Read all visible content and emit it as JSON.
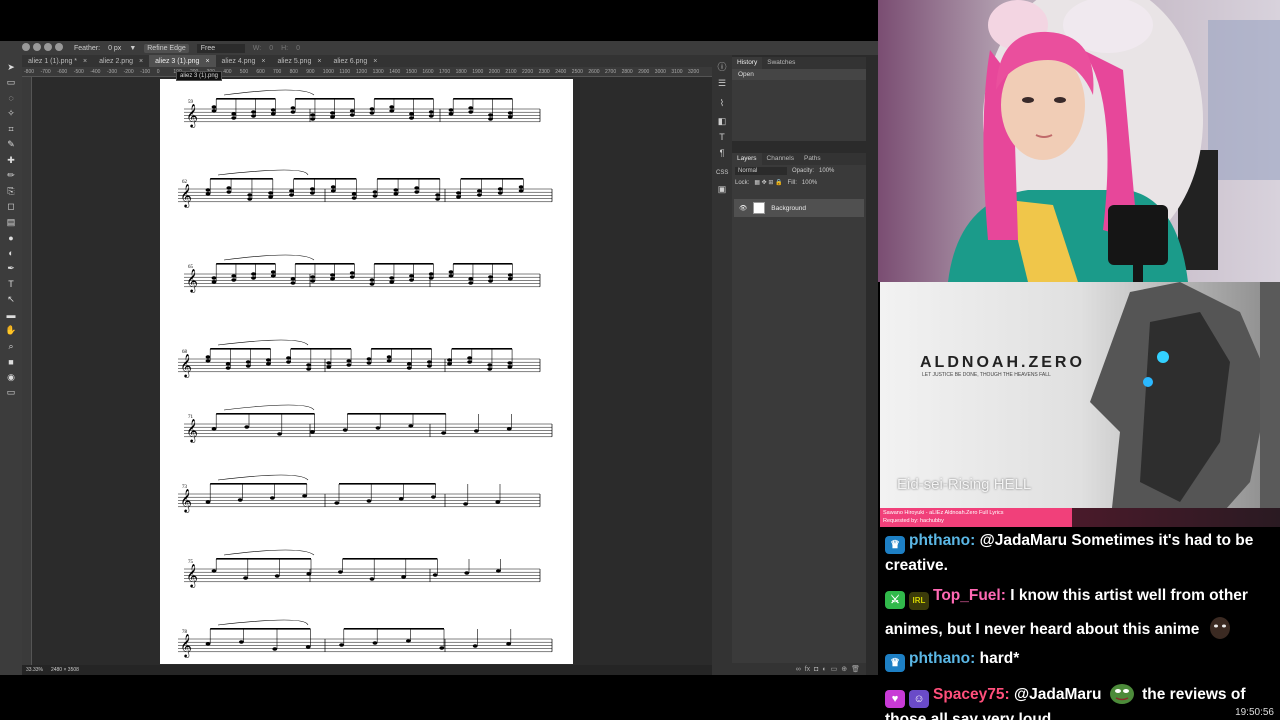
{
  "options_bar": {
    "feather_label": "Feather:",
    "feather_value": "0 px",
    "refine_label": "Refine Edge",
    "style_value": "Free",
    "w_label": "W:",
    "w_value": "0",
    "h_label": "H:",
    "h_value": "0"
  },
  "tabs": [
    {
      "label": "aliez 1 (1).png *",
      "active": false
    },
    {
      "label": "aliez 2.png",
      "active": false
    },
    {
      "label": "aliez 3 (1).png",
      "active": true
    },
    {
      "label": "aliez 4.png",
      "active": false
    },
    {
      "label": "aliez 5.png",
      "active": false
    },
    {
      "label": "aliez 6.png",
      "active": false
    }
  ],
  "tooltip": "aliez 3 (1).png",
  "ruler_ticks": [
    "-800",
    "-700",
    "-600",
    "-500",
    "-400",
    "-300",
    "-200",
    "-100",
    "0",
    "100",
    "200",
    "300",
    "400",
    "500",
    "600",
    "700",
    "800",
    "900",
    "1000",
    "1100",
    "1200",
    "1300",
    "1400",
    "1500",
    "1600",
    "1700",
    "1800",
    "1900",
    "2000",
    "2100",
    "2200",
    "2300",
    "2400",
    "2500",
    "2600",
    "2700",
    "2800",
    "2900",
    "3000",
    "3100",
    "3200"
  ],
  "status": {
    "zoom": "33.33%",
    "size": "2480 × 3508"
  },
  "history_panel": {
    "tabs": [
      "History",
      "Swatches"
    ],
    "item": "Open"
  },
  "layers_panel": {
    "tabs": [
      "Layers",
      "Channels",
      "Paths"
    ],
    "blend": "Normal",
    "opacity_label": "Opacity:",
    "opacity": "100%",
    "lock_label": "Lock:",
    "fill_label": "Fill:",
    "fill": "100%",
    "layer_name": "Background"
  },
  "score": {
    "measure_numbers": [
      "59",
      "62",
      "65",
      "68",
      "71",
      "73",
      "75",
      "78"
    ]
  },
  "music_overlay": {
    "title": "ALDNOAH.ZERO",
    "subtitle": "LET JUSTICE BE DONE, THOUGH THE HEAVENS FALL",
    "lyric": "Eid-sei-Rising HELL",
    "now_playing": "Sawano Hiroyuki - aLIEz Aldnoah.Zero Full Lyrics",
    "requested_by": "Requested by: hachubby"
  },
  "chat": [
    {
      "user": "phthano",
      "color": "#5bb7e5",
      "badges": [
        "prime"
      ],
      "text": "@JadaMaru Sometimes it's had to be creative."
    },
    {
      "user": "Top_Fuel",
      "color": "#ff69b4",
      "badges": [
        "sword",
        "irl"
      ],
      "text": "I know this artist well from other animes, but I never heard about this anime",
      "emote": true
    },
    {
      "user": "phthano",
      "color": "#5bb7e5",
      "badges": [
        "prime"
      ],
      "text": "hard*"
    },
    {
      "user": "Spacey75",
      "color": "#ff4f7b",
      "badges": [
        "heart",
        "sub"
      ],
      "text": "@JadaMaru",
      "text2": "the reviews of those all say very loud",
      "emote": "pepe"
    }
  ],
  "clock": "19:50:56"
}
